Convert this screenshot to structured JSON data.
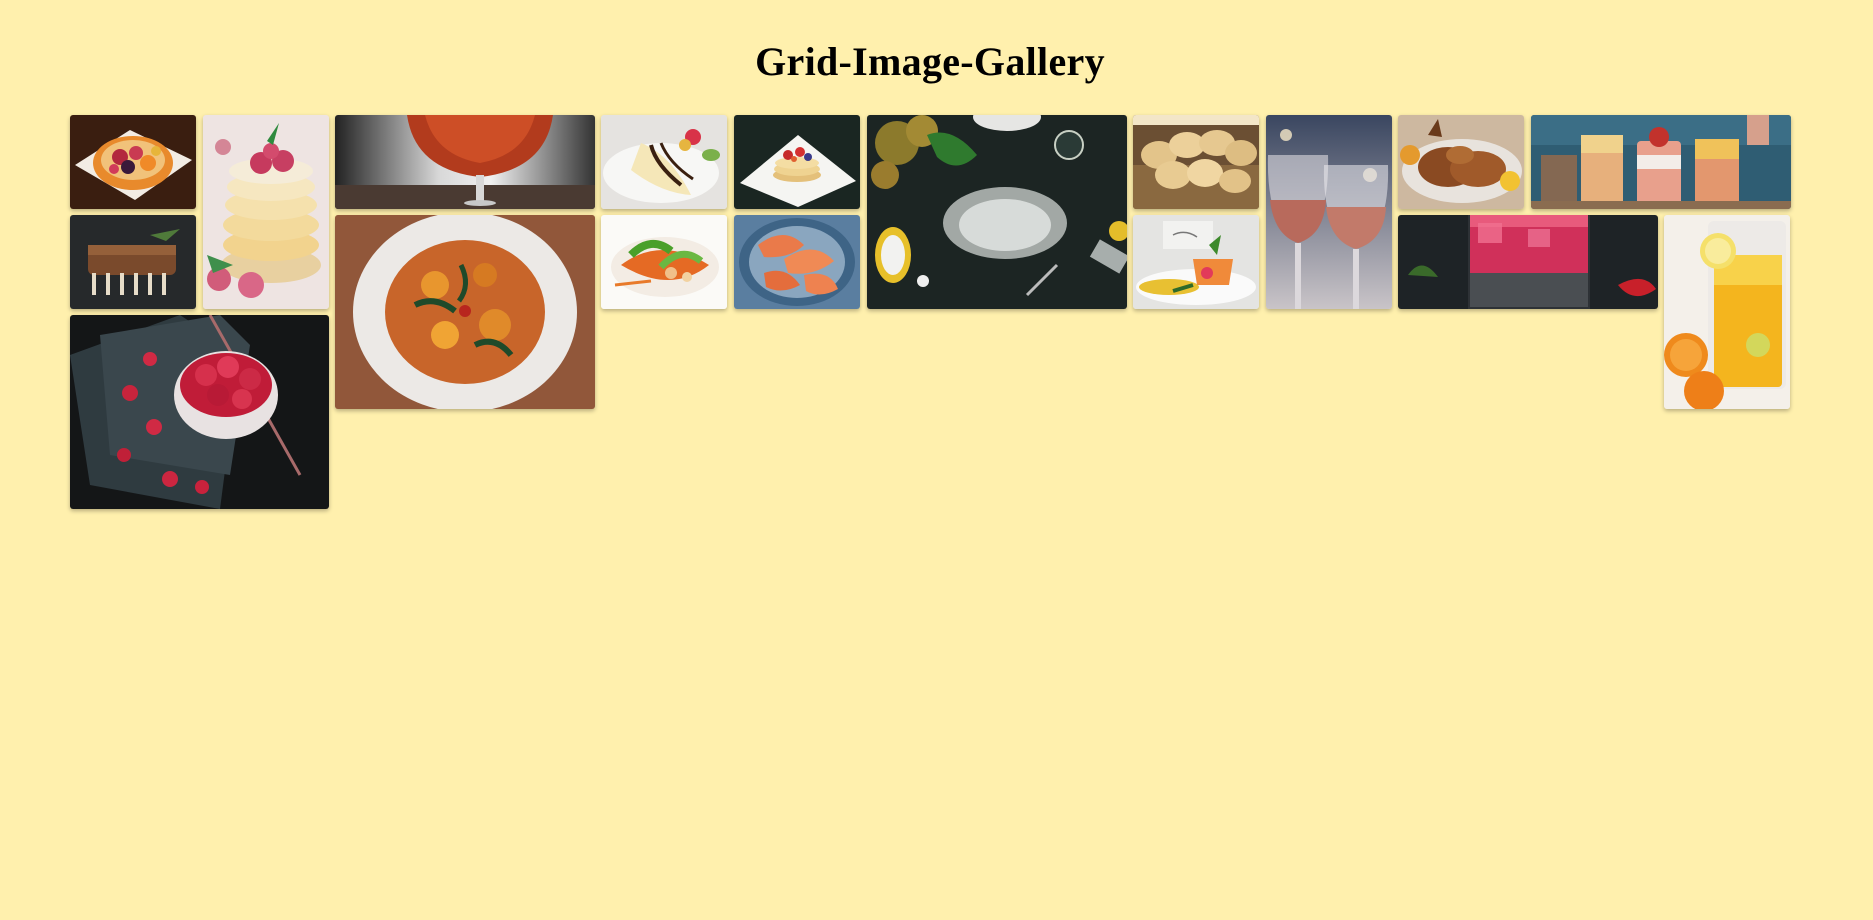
{
  "page": {
    "title": "Grid-Image-Gallery",
    "background": "#fff0ad"
  },
  "gallery": {
    "images": [
      {
        "name": "fruit-tart-image",
        "subject": "fruit tart"
      },
      {
        "name": "raspberry-pancakes-image",
        "subject": "raspberry pancakes"
      },
      {
        "name": "red-wine-glass-image",
        "subject": "red wine glass"
      },
      {
        "name": "banana-dessert-image",
        "subject": "banana dessert"
      },
      {
        "name": "strawberry-pancakes-image",
        "subject": "strawberry pancakes"
      },
      {
        "name": "flour-table-image",
        "subject": "flour on table"
      },
      {
        "name": "cream-puffs-image",
        "subject": "cream puffs"
      },
      {
        "name": "rose-wine-glasses-image",
        "subject": "rose wine glasses"
      },
      {
        "name": "roast-chicken-image",
        "subject": "roast chicken"
      },
      {
        "name": "smoothie-jars-image",
        "subject": "smoothie jars"
      },
      {
        "name": "lamb-rack-image",
        "subject": "rack of lamb"
      },
      {
        "name": "pasta-bowl-image",
        "subject": "pasta bowl"
      },
      {
        "name": "papaya-salad-image",
        "subject": "papaya salad"
      },
      {
        "name": "shrimp-plate-image",
        "subject": "shrimp plate"
      },
      {
        "name": "plated-dish-image",
        "subject": "plated dish"
      },
      {
        "name": "red-drink-image",
        "subject": "red drink"
      },
      {
        "name": "orange-juice-image",
        "subject": "orange juice"
      },
      {
        "name": "raspberry-parfait-image",
        "subject": "raspberry parfait"
      }
    ]
  }
}
